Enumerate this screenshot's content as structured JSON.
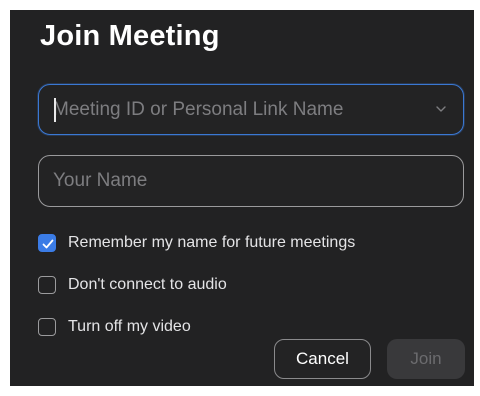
{
  "dialog": {
    "title": "Join Meeting"
  },
  "meeting_field": {
    "placeholder": "Meeting ID or Personal Link Name",
    "value": "",
    "dropdown_icon": "chevron-down-icon"
  },
  "name_field": {
    "placeholder": "Your Name",
    "value": ""
  },
  "options": [
    {
      "label": "Remember my name for future meetings",
      "checked": true
    },
    {
      "label": "Don't connect to audio",
      "checked": false
    },
    {
      "label": "Turn off my video",
      "checked": false
    }
  ],
  "buttons": {
    "cancel_label": "Cancel",
    "join_label": "Join",
    "join_enabled": false
  },
  "colors": {
    "background": "#222223",
    "accent": "#3b7ce6",
    "focus_border": "#3a78d3",
    "disabled_button": "#39393b"
  }
}
